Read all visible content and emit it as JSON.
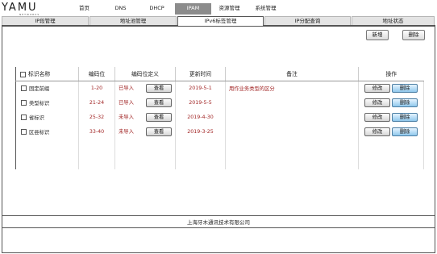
{
  "logo": {
    "text": "YAMU",
    "sub": "NETWORKS"
  },
  "topnav": [
    "首页",
    "DNS",
    "DHCP",
    "IPAM",
    "资源管理",
    "系统管理"
  ],
  "tabs": [
    "IP段管理",
    "地址池管理",
    "IPv6标签管理",
    "IP分配查询",
    "地址状态"
  ],
  "active_tab": "IPv6标签管理",
  "toolbar": {
    "add_label": "新增",
    "delete_label": "删除"
  },
  "table": {
    "headers": [
      "标识名称",
      "编码位",
      "编码位定义",
      "更新时间",
      "备注",
      "操作"
    ],
    "rows": [
      {
        "name": "固定前缀",
        "code": "1-20",
        "def": "已导入",
        "view": "查看",
        "time": "2019-5-1",
        "note": "用作业务类型的区分",
        "edit": "修改",
        "del": "删除"
      },
      {
        "name": "类型标识",
        "code": "21-24",
        "def": "已导入",
        "view": "查看",
        "time": "2019-5-5",
        "note": "",
        "edit": "修改",
        "del": "删除"
      },
      {
        "name": "省标识",
        "code": "25-32",
        "def": "未导入",
        "view": "查看",
        "time": "2019-4-30",
        "note": "",
        "edit": "修改",
        "del": "删除"
      },
      {
        "name": "区县标识",
        "code": "33-40",
        "def": "未导入",
        "view": "查看",
        "time": "2019-3-25",
        "note": "",
        "edit": "修改",
        "del": "删除"
      }
    ]
  },
  "footer": "上海牙木通讯技术有限公司"
}
